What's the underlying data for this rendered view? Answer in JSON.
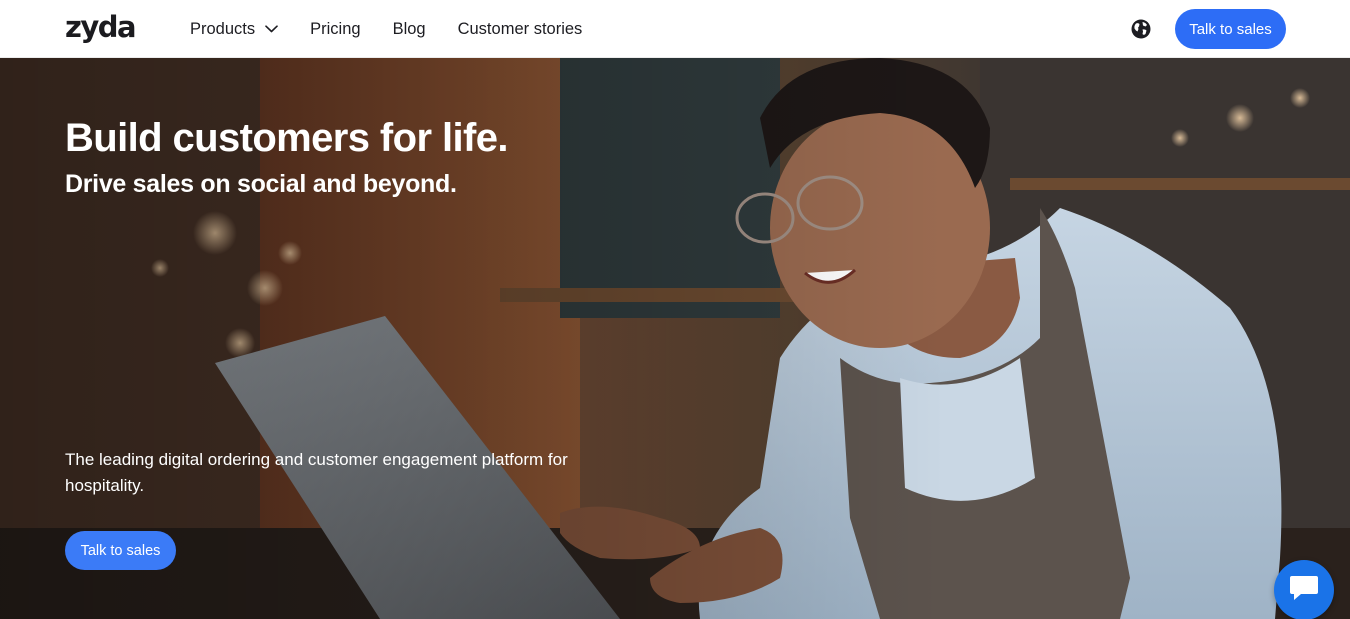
{
  "brand": {
    "logo_text": "zyda"
  },
  "nav": {
    "items": [
      {
        "label": "Products",
        "has_dropdown": true
      },
      {
        "label": "Pricing"
      },
      {
        "label": "Blog"
      },
      {
        "label": "Customer stories"
      }
    ],
    "cta_label": "Talk to sales",
    "language_icon": "globe-icon"
  },
  "hero": {
    "headline": "Build customers for life.",
    "subheadline": "Drive sales on social and beyond.",
    "description": "The leading digital ordering and customer engagement platform for hospitality.",
    "cta_label": "Talk to sales"
  },
  "chat": {
    "icon": "chat-bubble-icon"
  },
  "colors": {
    "accent": "#2d6df6",
    "hero_button": "#3b7bf7",
    "chat_widget": "#1a73e8",
    "nav_text": "#1d1d22"
  }
}
